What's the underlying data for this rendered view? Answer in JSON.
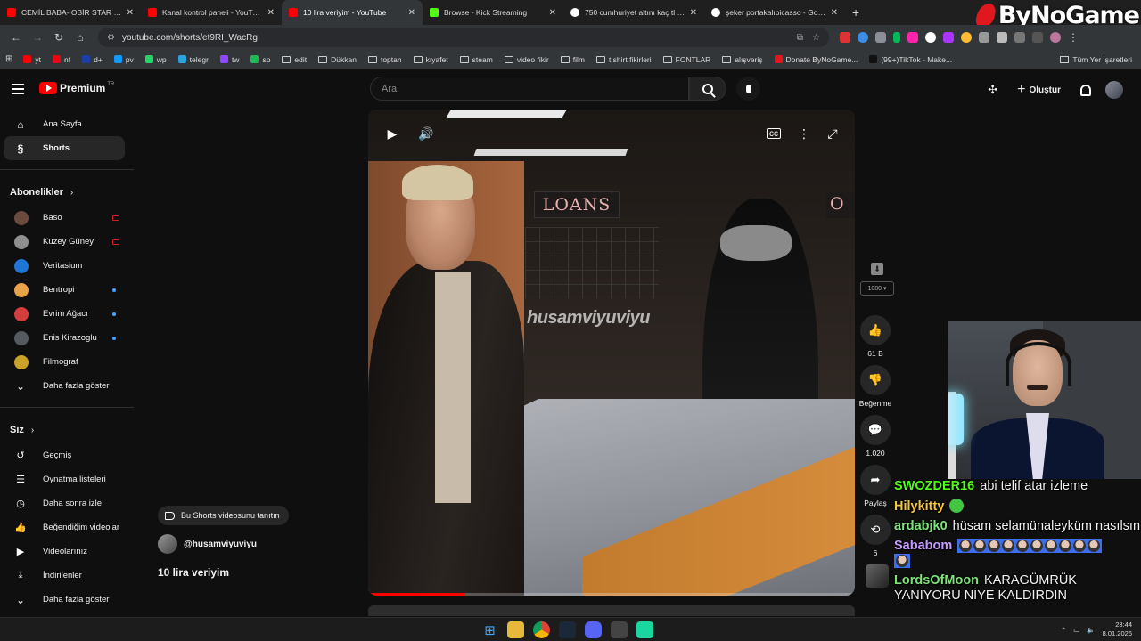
{
  "browser": {
    "tabs": [
      {
        "label": "CEMİL BABA- OBİR STAR -CAN",
        "fav": "yt",
        "active": false
      },
      {
        "label": "Kanal kontrol paneli - YouTube",
        "fav": "yt",
        "active": false
      },
      {
        "label": "10 lira veriyim - YouTube",
        "fav": "yt",
        "active": true
      },
      {
        "label": "Browse - Kick Streaming",
        "fav": "kick",
        "active": false
      },
      {
        "label": "750 cumhuriyet altını kaç tl - G",
        "fav": "g",
        "active": false
      },
      {
        "label": "şeker portakalıpicasso - Google",
        "fav": "g",
        "active": false
      }
    ],
    "url": "youtube.com/shorts/et9RI_WacRg",
    "bookmarks": [
      {
        "label": "yt",
        "type": "site",
        "color": "#ff0000"
      },
      {
        "label": "nf",
        "type": "site",
        "color": "#e50914"
      },
      {
        "label": "d+",
        "type": "site",
        "color": "#1a3fa8"
      },
      {
        "label": "pv",
        "type": "site",
        "color": "#1399ff"
      },
      {
        "label": "wp",
        "type": "site",
        "color": "#25d366"
      },
      {
        "label": "telegr",
        "type": "site",
        "color": "#2aa3df"
      },
      {
        "label": "tw",
        "type": "site",
        "color": "#9146ff"
      },
      {
        "label": "sp",
        "type": "site",
        "color": "#1db954"
      },
      {
        "label": "edit",
        "type": "folder"
      },
      {
        "label": "Dükkan",
        "type": "folder"
      },
      {
        "label": "toptan",
        "type": "folder"
      },
      {
        "label": "kıyafet",
        "type": "folder"
      },
      {
        "label": "steam",
        "type": "folder"
      },
      {
        "label": "video fikir",
        "type": "folder"
      },
      {
        "label": "film",
        "type": "folder"
      },
      {
        "label": "t shirt fikirleri",
        "type": "folder"
      },
      {
        "label": "FONTLAR",
        "type": "folder"
      },
      {
        "label": "alışveriş",
        "type": "folder"
      },
      {
        "label": "Donate ByNoGame...",
        "type": "site",
        "color": "#e0171f"
      },
      {
        "label": "(99+)TikTok - Make...",
        "type": "site",
        "color": "#111111"
      }
    ],
    "all_bookmarks": "Tüm Yer İşaretleri",
    "watermark_logo": "ByNoGame"
  },
  "youtube": {
    "brand": "Premium",
    "brand_sup": "TR",
    "search_placeholder": "Ara",
    "create_label": "Oluştur",
    "sidebar": {
      "main": [
        {
          "label": "Ana Sayfa",
          "icon": "home-icon",
          "glyph": "⌂",
          "active": false
        },
        {
          "label": "Shorts",
          "icon": "shorts-icon",
          "glyph": "§",
          "active": true
        }
      ],
      "subs_heading": "Abonelikler",
      "subs": [
        {
          "label": "Baso",
          "color": "#6b4b3e",
          "badge": "live"
        },
        {
          "label": "Kuzey Güney",
          "color": "#8f8f8f",
          "badge": "live"
        },
        {
          "label": "Veritasium",
          "color": "#1e77d4",
          "badge": ""
        },
        {
          "label": "Bentropi",
          "color": "#e8a24a",
          "badge": "dot"
        },
        {
          "label": "Evrim Ağacı",
          "color": "#d43d3d",
          "badge": "dot"
        },
        {
          "label": "Enis Kirazoglu",
          "color": "#555a60",
          "badge": "dot"
        },
        {
          "label": "Filmograf",
          "color": "#c9a227",
          "badge": ""
        }
      ],
      "subs_more": "Daha fazla göster",
      "you_heading": "Siz",
      "you": [
        {
          "label": "Geçmiş",
          "icon": "history-icon",
          "glyph": "↺"
        },
        {
          "label": "Oynatma listeleri",
          "icon": "playlists-icon",
          "glyph": "☰"
        },
        {
          "label": "Daha sonra izle",
          "icon": "watch-later-icon",
          "glyph": "◷"
        },
        {
          "label": "Beğendiğim videolar",
          "icon": "liked-videos-icon",
          "glyph": "👍"
        },
        {
          "label": "Videolarınız",
          "icon": "your-videos-icon",
          "glyph": "▶"
        },
        {
          "label": "İndirilenler",
          "icon": "downloads-icon",
          "glyph": "⤓"
        }
      ],
      "you_more": "Daha fazla göster"
    },
    "short": {
      "watermark": "husamviyuviyu",
      "loans_sign": "LOANS",
      "loans_sign_2": "O",
      "promote_label": "Bu Shorts videosunu tanıtın",
      "channel": "@husamviyuviyu",
      "title": "10 lira veriyim",
      "progress": 0.2
    },
    "actions": {
      "quality": "1080",
      "likes": "61 B",
      "dislike_label": "Beğenme",
      "comments": "1.020",
      "share_label": "Paylaş",
      "remix_count": "6"
    }
  },
  "chat": [
    {
      "user": "SWOZDER16",
      "color": "#53fc18",
      "text": "abi telif atar izleme",
      "emote": ""
    },
    {
      "user": "Hilykitty",
      "color": "#f4c542",
      "text": "",
      "emote": "green"
    },
    {
      "user": "ardabjk0",
      "color": "#7fe37a",
      "text": "hüsam selamünaleyküm nasılsın",
      "emote": ""
    },
    {
      "user": "Sababom",
      "color": "#c59cff",
      "text": "",
      "emote": "strip"
    },
    {
      "user": "LordsOfMoon",
      "color": "#7fe37a",
      "text": "KARAGÜMRÜK YANIYORU NİYE KALDIRDIN",
      "emote": ""
    }
  ],
  "taskbar": {
    "time": "23:44",
    "date": "8.01.2026"
  }
}
